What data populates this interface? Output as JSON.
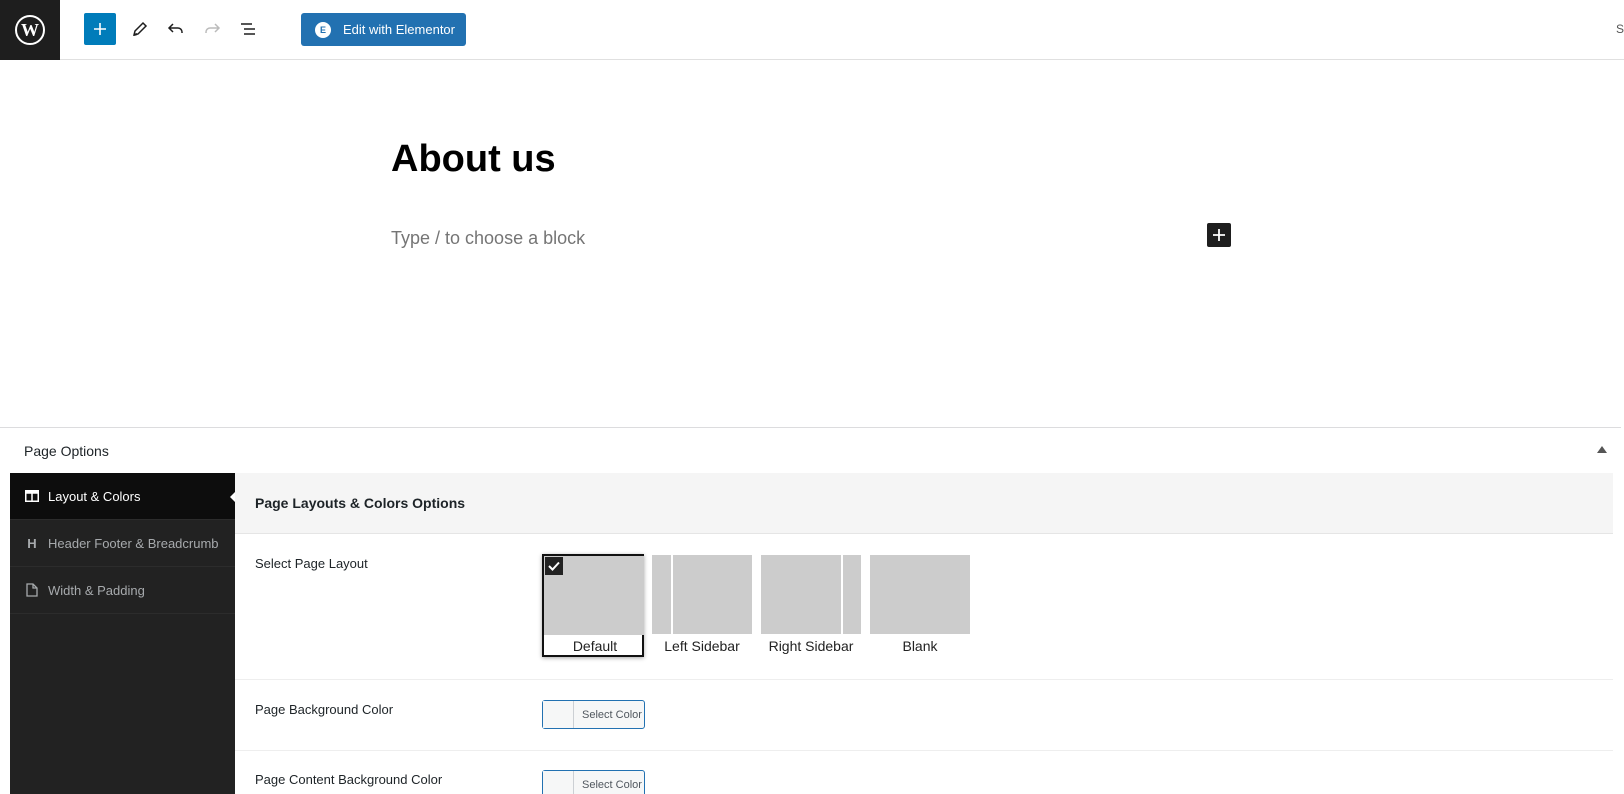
{
  "toolbar": {
    "edit_with_elementor": "Edit with Elementor",
    "edge_char": "S"
  },
  "editor": {
    "title": "About us",
    "block_placeholder": "Type / to choose a block"
  },
  "metabox": {
    "title": "Page Options",
    "sidebar": {
      "items": [
        {
          "label": "Layout & Colors",
          "icon": "layout-icon",
          "active": true
        },
        {
          "label": "Header Footer & Breadcrumb",
          "icon": "heading-icon",
          "active": false
        },
        {
          "label": "Width & Padding",
          "icon": "page-icon",
          "active": false
        }
      ]
    },
    "panel": {
      "heading": "Page Layouts & Colors Options",
      "layout_label": "Select Page Layout",
      "layouts": [
        "Default",
        "Left Sidebar",
        "Right Sidebar",
        "Blank"
      ],
      "selected_layout": "Default",
      "bg_color_label": "Page Background Color",
      "content_bg_color_label": "Page Content Background Color",
      "select_color": "Select Color"
    }
  },
  "colors": {
    "primary": "#007cba",
    "elementor": "#2271b1",
    "sidebar_bg": "#222222",
    "layout_thumb": "#cccccc"
  }
}
